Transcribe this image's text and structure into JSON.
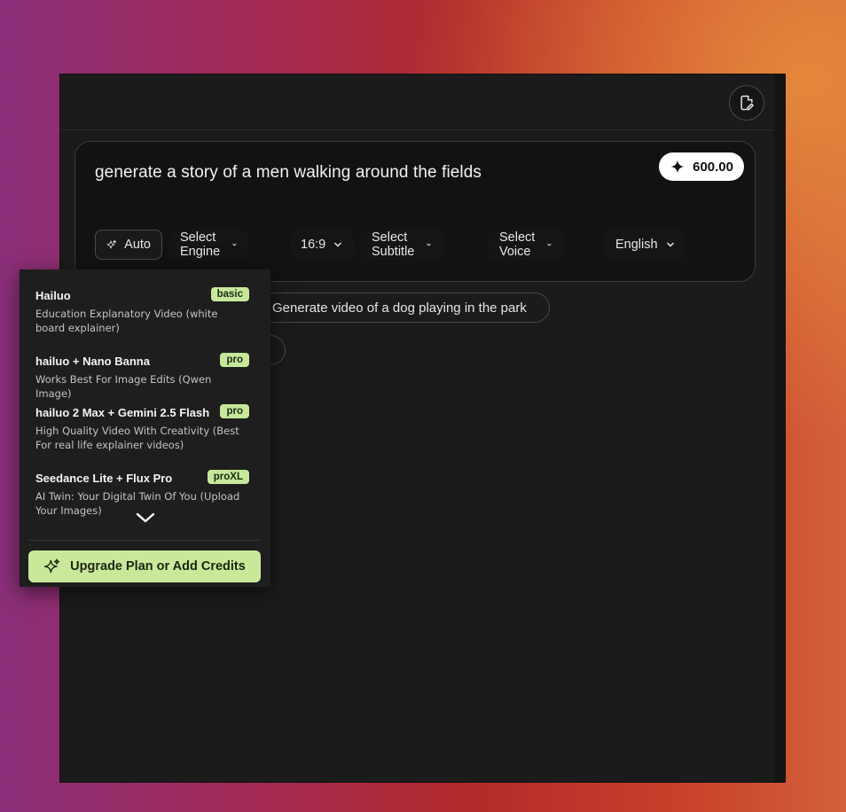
{
  "prompt": {
    "text": "generate a story of a men walking around the fields",
    "credits": "600.00"
  },
  "toolbar": {
    "auto": "Auto",
    "engine": "Select Engine",
    "ratio": "16:9",
    "subtitle": "Select Subtitle",
    "voice": "Select Voice",
    "language": "English"
  },
  "suggestions": [
    "Generate video of a dog playing in the park"
  ],
  "engine_menu": {
    "options": [
      {
        "title": "Hailuo",
        "badge": "basic",
        "desc": "Education Explanatory Video (white board explainer)"
      },
      {
        "title": "hailuo + Nano Banna",
        "badge": "pro",
        "desc": "Works Best For Image Edits (Qwen Image)"
      },
      {
        "title": "hailuo 2 Max + Gemini 2.5 Flash",
        "badge": "pro",
        "desc": "High Quality Video With Creativity (Best For real life explainer videos)"
      },
      {
        "title": "Seedance Lite + Flux Pro",
        "badge": "proXL",
        "desc": "AI Twin: Your Digital Twin Of You (Upload Your Images)"
      }
    ],
    "upgrade_label": "Upgrade Plan or Add Credits"
  },
  "icons": {
    "doc": "document-edit-icon",
    "sparkle": "sparkle-icon",
    "chevron": "chevron-down-icon"
  },
  "colors": {
    "badge_bg": "#c7e89b",
    "upgrade_bg": "#c9e89a",
    "panel_bg": "#1b1b1b"
  }
}
